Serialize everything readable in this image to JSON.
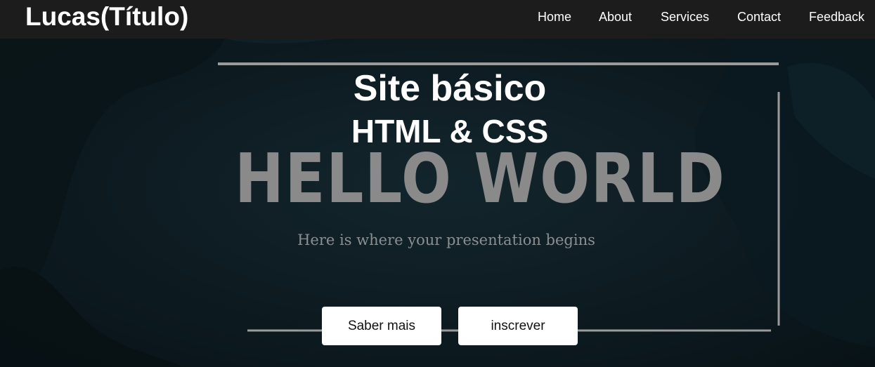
{
  "nav": {
    "brand": "Lucas(Título)",
    "links": [
      "Home",
      "About",
      "Services",
      "Contact",
      "Feedback"
    ]
  },
  "hero": {
    "title": "Site básico",
    "subtitle": "HTML & CSS",
    "background_heading": "HELLO WORLD",
    "background_caption": "Here is where your presentation begins",
    "buttons": [
      "Saber mais",
      "inscrever"
    ]
  },
  "colors": {
    "navbar": "#1c1c1c",
    "hero_background": "#0d1b21",
    "text": "#ffffff",
    "button_background": "#ffffff",
    "button_text": "#111111"
  }
}
